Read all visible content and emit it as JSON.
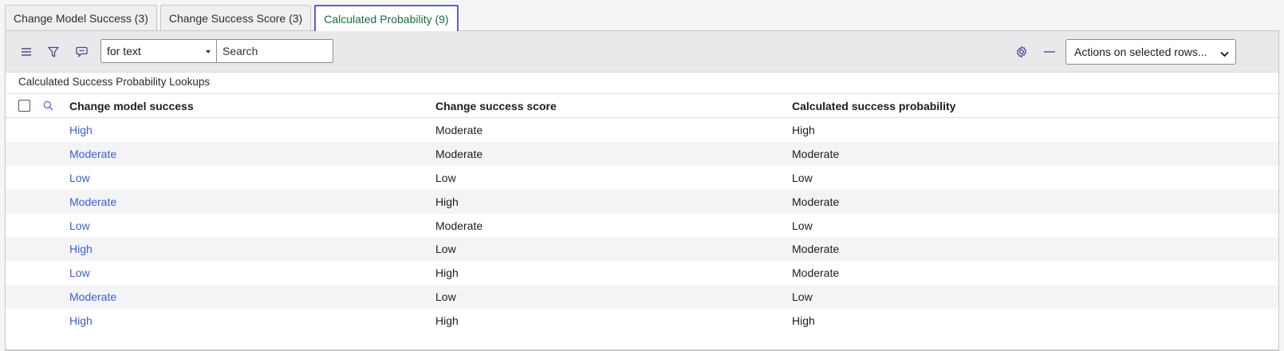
{
  "tabs": [
    {
      "label": "Change Model Success (3)"
    },
    {
      "label": "Change Success Score (3)"
    },
    {
      "label": "Calculated Probability (9)"
    }
  ],
  "toolbar": {
    "filter_field": "for text",
    "search_placeholder": "Search",
    "actions_label": "Actions on selected rows..."
  },
  "icons": {
    "menu": "hamburger-icon",
    "filter": "funnel-icon",
    "comment": "speech-bubble-icon",
    "settings": "gear-icon",
    "collapse": "minus-icon",
    "search": "search-icon"
  },
  "list": {
    "title": "Calculated Success Probability Lookups",
    "columns": [
      "Change model success",
      "Change success score",
      "Calculated success probability"
    ],
    "rows": [
      [
        "High",
        "Moderate",
        "High"
      ],
      [
        "Moderate",
        "Moderate",
        "Moderate"
      ],
      [
        "Low",
        "Low",
        "Low"
      ],
      [
        "Moderate",
        "High",
        "Moderate"
      ],
      [
        "Low",
        "Moderate",
        "Low"
      ],
      [
        "High",
        "Low",
        "Moderate"
      ],
      [
        "Low",
        "High",
        "Moderate"
      ],
      [
        "Moderate",
        "Low",
        "Low"
      ],
      [
        "High",
        "High",
        "High"
      ]
    ]
  },
  "colors": {
    "link": "#3c5fd3",
    "active_tab_text": "#1a6b3f",
    "active_tab_border": "#5a5fc8"
  }
}
